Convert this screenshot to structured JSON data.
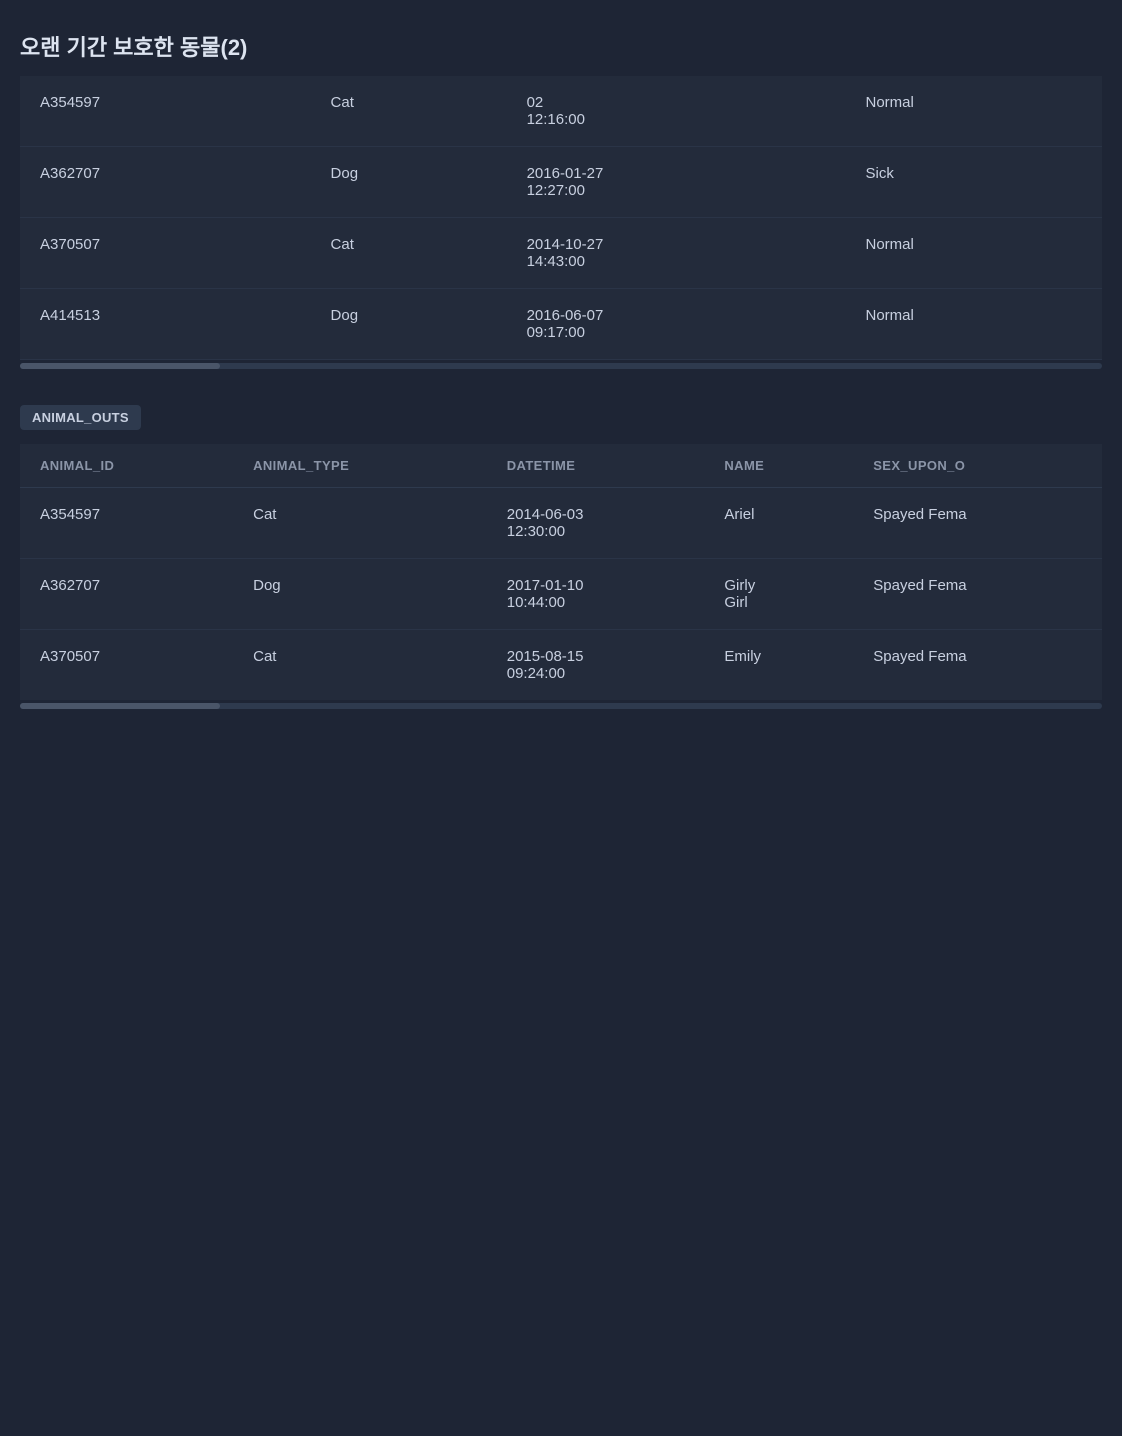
{
  "page": {
    "title": "오랜 기간 보호한 동물(2)"
  },
  "top_table": {
    "rows": [
      {
        "animal_id": "A354597",
        "animal_type": "Cat",
        "datetime": "02\n12:16:00",
        "condition": "Normal"
      },
      {
        "animal_id": "A362707",
        "animal_type": "Dog",
        "datetime": "2016-01-27\n12:27:00",
        "condition": "Sick"
      },
      {
        "animal_id": "A370507",
        "animal_type": "Cat",
        "datetime": "2014-10-27\n14:43:00",
        "condition": "Normal"
      },
      {
        "animal_id": "A414513",
        "animal_type": "Dog",
        "datetime": "2016-06-07\n09:17:00",
        "condition": "Normal"
      }
    ]
  },
  "animal_outs_tag": "ANIMAL_OUTS",
  "animal_outs_table": {
    "headers": [
      "ANIMAL_ID",
      "ANIMAL_TYPE",
      "DATETIME",
      "NAME",
      "SEX_UPON_O"
    ],
    "rows": [
      {
        "animal_id": "A354597",
        "animal_type": "Cat",
        "datetime": "2014-06-03\n12:30:00",
        "name": "Ariel",
        "sex_upon": "Spayed Fema"
      },
      {
        "animal_id": "A362707",
        "animal_type": "Dog",
        "datetime": "2017-01-10\n10:44:00",
        "name": "Girly Girl",
        "sex_upon": "Spayed Fema"
      },
      {
        "animal_id": "A370507",
        "animal_type": "Cat",
        "datetime": "2015-08-15\n09:24:00",
        "name": "Emily",
        "sex_upon": "Spayed Fema"
      }
    ]
  },
  "bottom_scrollbar": true
}
